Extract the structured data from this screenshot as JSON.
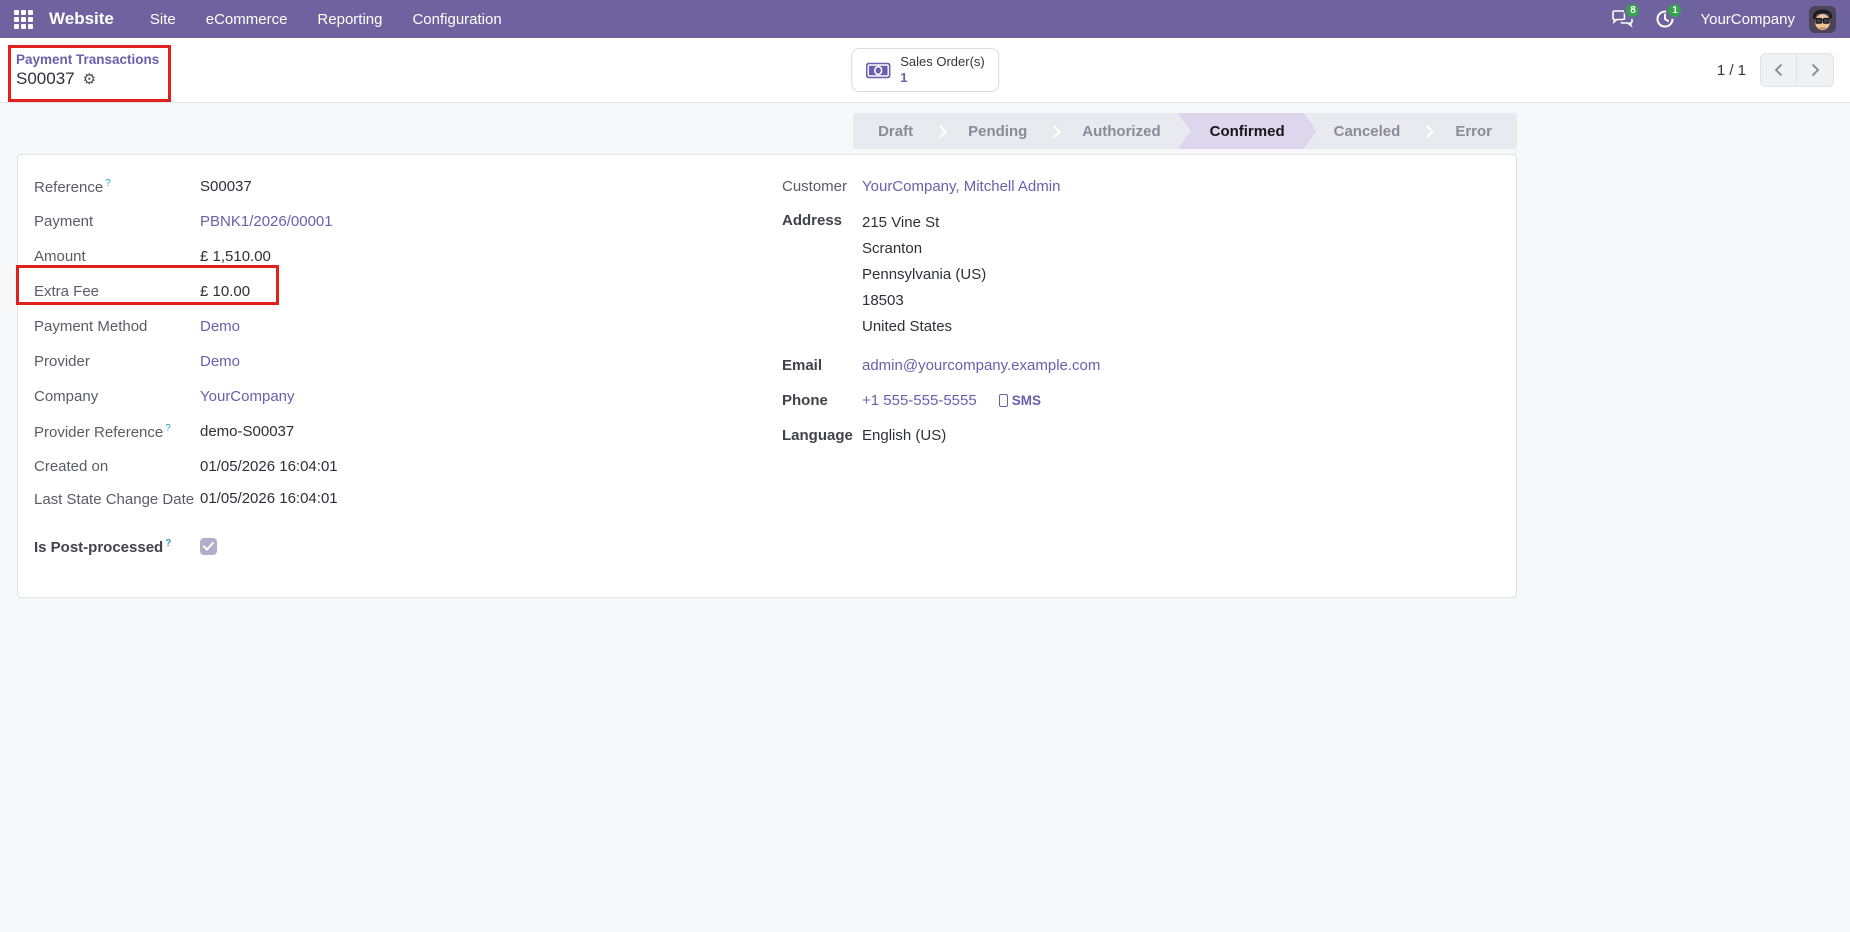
{
  "navbar": {
    "brand": "Website",
    "menus": [
      {
        "label": "Site"
      },
      {
        "label": "eCommerce"
      },
      {
        "label": "Reporting"
      },
      {
        "label": "Configuration"
      }
    ],
    "messages_badge": "8",
    "activities_badge": "1",
    "user_name": "YourCompany",
    "colors": {
      "navbar_bg": "#6e639e",
      "badge_green": "#35a24e"
    }
  },
  "control_panel": {
    "breadcrumb_parent": "Payment Transactions",
    "breadcrumb_active": "S00037",
    "stat_button": {
      "label": "Sales Order(s)",
      "value": "1"
    },
    "pager": {
      "counter": "1 / 1",
      "prev": "‹",
      "next": "›"
    }
  },
  "statusbar": {
    "steps": [
      {
        "label": "Draft",
        "active": false
      },
      {
        "label": "Pending",
        "active": false
      },
      {
        "label": "Authorized",
        "active": false
      },
      {
        "label": "Confirmed",
        "active": true
      },
      {
        "label": "Canceled",
        "active": false
      },
      {
        "label": "Error",
        "active": false
      }
    ],
    "colors": {
      "active_bg": "#ded6ec",
      "active_outline": "#7568a9",
      "bar_bg": "#e9eaef"
    }
  },
  "form": {
    "left": [
      {
        "label": "Reference",
        "value": "S00037"
      },
      {
        "label": "Payment",
        "value": "PBNK1/2026/00001"
      },
      {
        "label": "Amount",
        "value": "£ 1,510.00"
      },
      {
        "label": "Extra Fee",
        "value": "£ 10.00"
      },
      {
        "label": "Payment Method",
        "value": "Demo"
      },
      {
        "label": "Provider",
        "value": "Demo"
      },
      {
        "label": "Company",
        "value": "YourCompany"
      },
      {
        "label": "Provider Reference",
        "value": "demo-S00037"
      },
      {
        "label": "Created on",
        "value": "01/05/2026 16:04:01"
      },
      {
        "label": "Last State Change Date",
        "value": "01/05/2026 16:04:01"
      },
      {
        "label": "Is Post-processed",
        "checked": true
      }
    ],
    "right": {
      "customer": {
        "label": "Customer",
        "value": "YourCompany, Mitchell Admin"
      },
      "address": {
        "label": "Address",
        "lines": [
          "215 Vine St",
          "Scranton",
          "Pennsylvania (US)",
          "18503",
          "United States"
        ]
      },
      "email": {
        "label": "Email",
        "value": "admin@yourcompany.example.com"
      },
      "phone": {
        "label": "Phone",
        "value": "+1 555-555-5555",
        "sms_label": "SMS"
      },
      "language": {
        "label": "Language",
        "value": "English (US)"
      }
    },
    "help_marker": "?",
    "link_color": "#6a5fae"
  },
  "annotations": {
    "color": "#e0201d"
  }
}
